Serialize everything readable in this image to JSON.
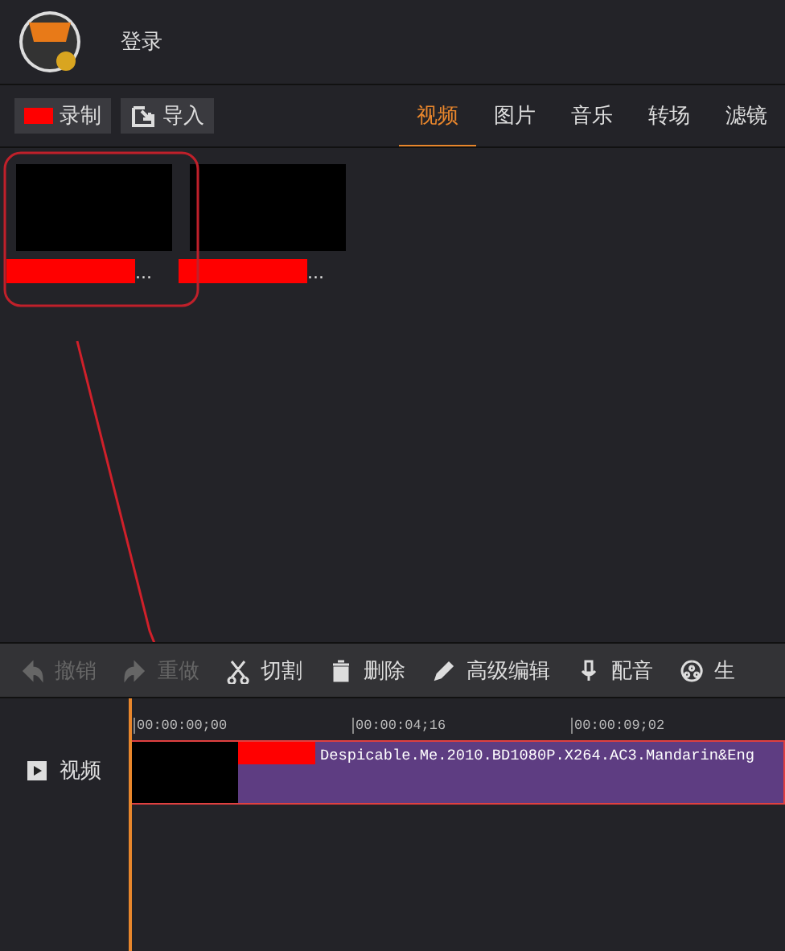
{
  "header": {
    "login": "登录"
  },
  "toolbar": {
    "buttons": [
      {
        "label": "录制",
        "kind": "record"
      },
      {
        "label": "导入",
        "kind": "import"
      }
    ],
    "tabs": [
      {
        "label": "视频",
        "selected": true
      },
      {
        "label": "图片",
        "selected": false
      },
      {
        "label": "音乐",
        "selected": false
      },
      {
        "label": "转场",
        "selected": false
      },
      {
        "label": "滤镜",
        "selected": false
      }
    ]
  },
  "media": [
    {
      "caption": "..."
    },
    {
      "caption": "..."
    }
  ],
  "edit_toolbar": [
    {
      "label": "撤销",
      "disabled": true
    },
    {
      "label": "重做",
      "disabled": true
    },
    {
      "label": "切割",
      "disabled": false
    },
    {
      "label": "删除",
      "disabled": false
    },
    {
      "label": "高级编辑",
      "disabled": false
    },
    {
      "label": "配音",
      "disabled": false
    },
    {
      "label": "生",
      "disabled": false
    }
  ],
  "timeline": {
    "track": "视频",
    "ruler": [
      "00:00:00;00",
      "00:00:04;16",
      "00:00:09;02"
    ],
    "clip": "Despicable.Me.2010.BD1080P.X264.AC3.Mandarin&Eng"
  }
}
